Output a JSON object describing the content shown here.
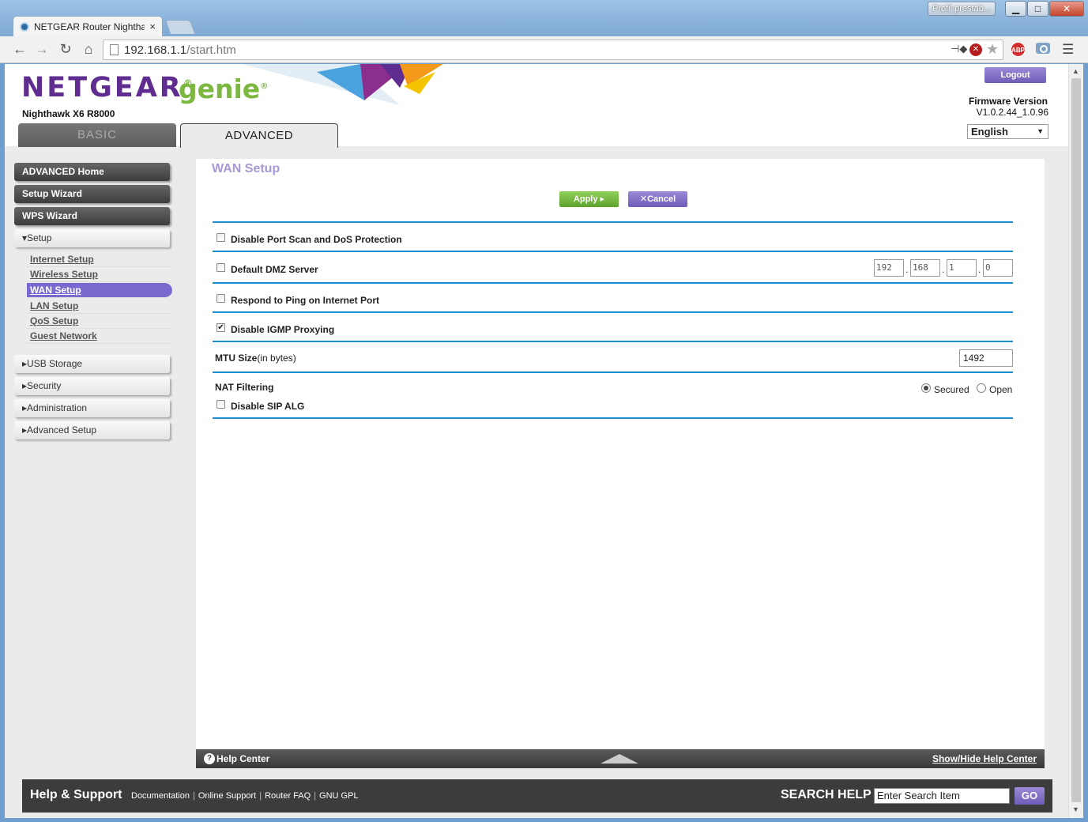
{
  "browser": {
    "tab_title": "NETGEAR Router Nightha",
    "tab_close": "×",
    "profile_label": "Profil prestab...",
    "address_host": "192.168.1.1",
    "address_path": "/start.htm",
    "adblock_label": "ABP",
    "icons": [
      "back-icon",
      "forward-icon",
      "reload-icon",
      "home-icon",
      "page-icon",
      "pin-icon",
      "blocked-icon",
      "star-icon",
      "adblock-icon",
      "camera-icon",
      "menu-icon"
    ]
  },
  "header": {
    "logo_main": "NETGEAR",
    "logo_reg": "®",
    "logo_sub": "genie",
    "model": "Nighthawk X6 R8000",
    "logout_label": "Logout",
    "firmware_label": "Firmware Version",
    "firmware_value": "V1.0.2.44_1.0.96",
    "language": "English",
    "tabs": {
      "basic": "BASIC",
      "advanced": "ADVANCED"
    }
  },
  "sidebar": {
    "advanced_home": "ADVANCED Home",
    "setup_wizard": "Setup Wizard",
    "wps_wizard": "WPS Wizard",
    "setup": "Setup",
    "setup_items": [
      "Internet Setup",
      "Wireless Setup",
      "WAN Setup",
      "LAN Setup",
      "QoS Setup",
      "Guest Network"
    ],
    "active_item": "WAN Setup",
    "usb_storage": "USB Storage",
    "security": "Security",
    "administration": "Administration",
    "advanced_setup": "Advanced Setup"
  },
  "content": {
    "title": "WAN Setup",
    "apply_label": "Apply",
    "cancel_label": "Cancel",
    "rows": {
      "port_scan": {
        "label": "Disable Port Scan and DoS Protection",
        "checked": false
      },
      "dmz": {
        "label": "Default DMZ Server",
        "checked": false,
        "ip": [
          "192",
          "168",
          "1",
          "0"
        ]
      },
      "ping": {
        "label": "Respond to Ping on Internet Port",
        "checked": false
      },
      "igmp": {
        "label": "Disable IGMP Proxying",
        "checked": true
      },
      "mtu": {
        "label": "MTU Size",
        "unit": "(in bytes)",
        "value": "1492"
      },
      "nat": {
        "label": "NAT Filtering",
        "options": [
          "Secured",
          "Open"
        ],
        "selected": "Secured"
      },
      "sip": {
        "label": "Disable SIP ALG",
        "checked": false
      }
    }
  },
  "help_bar": {
    "label": "Help Center",
    "toggle_label": "Show/Hide Help Center"
  },
  "footer": {
    "title": "Help & Support",
    "links": [
      "Documentation",
      "Online Support",
      "Router FAQ",
      "GNU GPL"
    ],
    "search_label": "SEARCH HELP",
    "search_value": "Enter Search Item",
    "go_label": "GO"
  },
  "colors": {
    "netgear_purple": "#5e2d8f",
    "genie_green": "#7cb83f",
    "divider_blue": "#1a8fcf",
    "active_purple": "#7a6ad0",
    "apply_green": "#6fb33a"
  }
}
